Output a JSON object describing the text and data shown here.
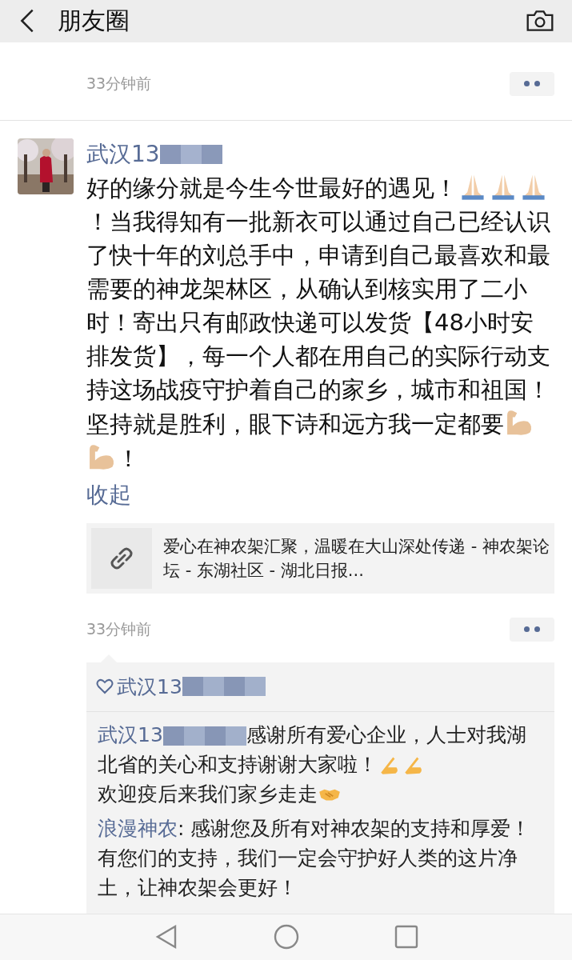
{
  "header": {
    "title": "朋友圈"
  },
  "top_post": {
    "time": "33分钟前"
  },
  "post": {
    "author": "武汉13",
    "author_redacted": true,
    "body": [
      {
        "kind": "text",
        "text": "好的缘分就是今生今世最好的遇见！"
      },
      {
        "kind": "pray"
      },
      {
        "kind": "pray"
      },
      {
        "kind": "pray"
      },
      {
        "kind": "text",
        "text": "！当我得知有一批新衣可以通过自己已经认识了快十年的刘总手中，申请到自己最喜欢和最需要的神龙架林区，从确认到核实用了二小时！寄出只有邮政快递可以发货【48小时安排发货】，每一个人都在用自己的实际行动支持这场战疫守护着自己的家乡，城市和祖国！坚持就是胜利，眼下诗和远方我一定都要"
      },
      {
        "kind": "flex"
      },
      {
        "kind": "flex"
      },
      {
        "kind": "text",
        "text": "！"
      }
    ],
    "collapse": "收起",
    "link": {
      "title": "爱心在神农架汇聚，温暖在大山深处传递 - 神农架论坛 - 东湖社区 - 湖北日报..."
    },
    "time": "33分钟前",
    "likes": [
      {
        "name": "武汉13",
        "redacted": true
      }
    ],
    "comments": [
      {
        "author": "武汉13",
        "redacted": true,
        "parts": [
          {
            "kind": "text",
            "text": "感谢所有爱心企业，人士对我湖北省的关心和支持谢谢大家啦！"
          },
          {
            "kind": "point"
          },
          {
            "kind": "point"
          },
          {
            "kind": "break"
          },
          {
            "kind": "text",
            "text": "欢迎疫后来我们家乡走走"
          },
          {
            "kind": "shake"
          }
        ]
      },
      {
        "author": "浪漫神农",
        "redacted": false,
        "parts": [
          {
            "kind": "text",
            "text": ": 感谢您及所有对神农架的支持和厚爱！有您们的支持，我们一定会守护好人类的这片净土，让神农架会更好！"
          }
        ]
      }
    ]
  }
}
